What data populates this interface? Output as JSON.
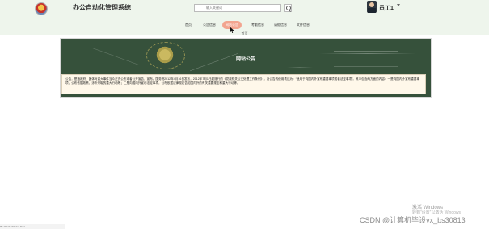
{
  "header": {
    "app_title": "办公自动化管理系统",
    "search_placeholder": "输入关键词",
    "user_name": "员工1"
  },
  "nav": {
    "items": [
      {
        "label": "首页"
      },
      {
        "label": "公告信息"
      },
      {
        "label": "网站公告",
        "active": true
      },
      {
        "label": "考勤信息"
      },
      {
        "label": "请假信息"
      },
      {
        "label": "文件信息"
      }
    ]
  },
  "breadcrumb": "首页",
  "banner": {
    "title": "网站公告"
  },
  "notice": {
    "text": "公告，是指政府、团体对重大事件当众正式公布或者公开宣告，宣布。国务院2012年4月16日发布，2012年7月1日起施行的《党政机关公文处理工作条例》，对公告的使用表述为：“适用于向国内外宣布重要事项或者法定事项”。其中包含两方面的内容：一是向国内外宣布重要事项，公布依据政策，涉令采取的重大行动等；二是向国内外宣布法定事项，公布依据法律规定告知国内外的有关重要规定和重大行动等。"
  },
  "status": {
    "url": "file:///D:/123/index.html"
  },
  "watermark": {
    "line1": "激活 Windows",
    "line2": "转到“设置”以激活 Windows",
    "csdn": "CSDN @计算机毕设vx_bs30813"
  },
  "colors": {
    "header_bg": "#eef5ec",
    "accent": "#f2a48f",
    "banner_bg": "#36513b",
    "notice_bg": "#fff8ea"
  }
}
